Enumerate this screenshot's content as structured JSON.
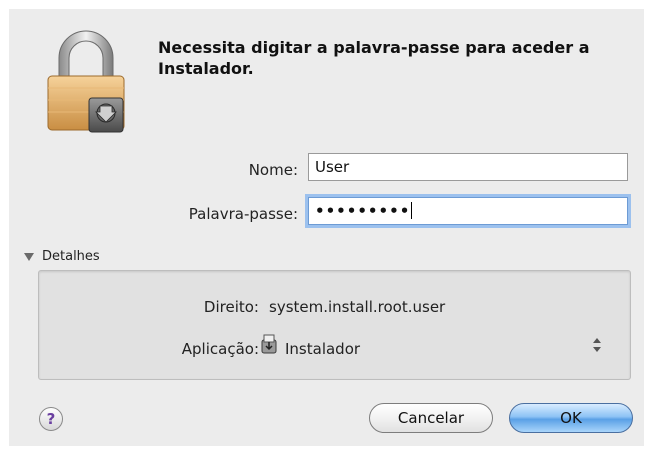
{
  "dialog": {
    "message": "Necessita digitar a palavra-passe para aceder a Instalador.",
    "icon": "lock-icon",
    "name_label": "Nome:",
    "name_value": "User",
    "password_label": "Palavra-passe:",
    "password_mask": "•••••••••",
    "details_toggle": "Detalhes",
    "details": {
      "right_label": "Direito:",
      "right_value": "system.install.root.user",
      "app_label": "Aplicação:",
      "app_value": "Instalador",
      "app_icon": "installer-icon"
    },
    "help_label": "?",
    "cancel_label": "Cancelar",
    "ok_label": "OK"
  },
  "colors": {
    "window_bg": "#ececec",
    "details_bg": "#e1e1e1",
    "focus_ring": "#9cc1ee",
    "default_button": "#5aa0e6"
  }
}
